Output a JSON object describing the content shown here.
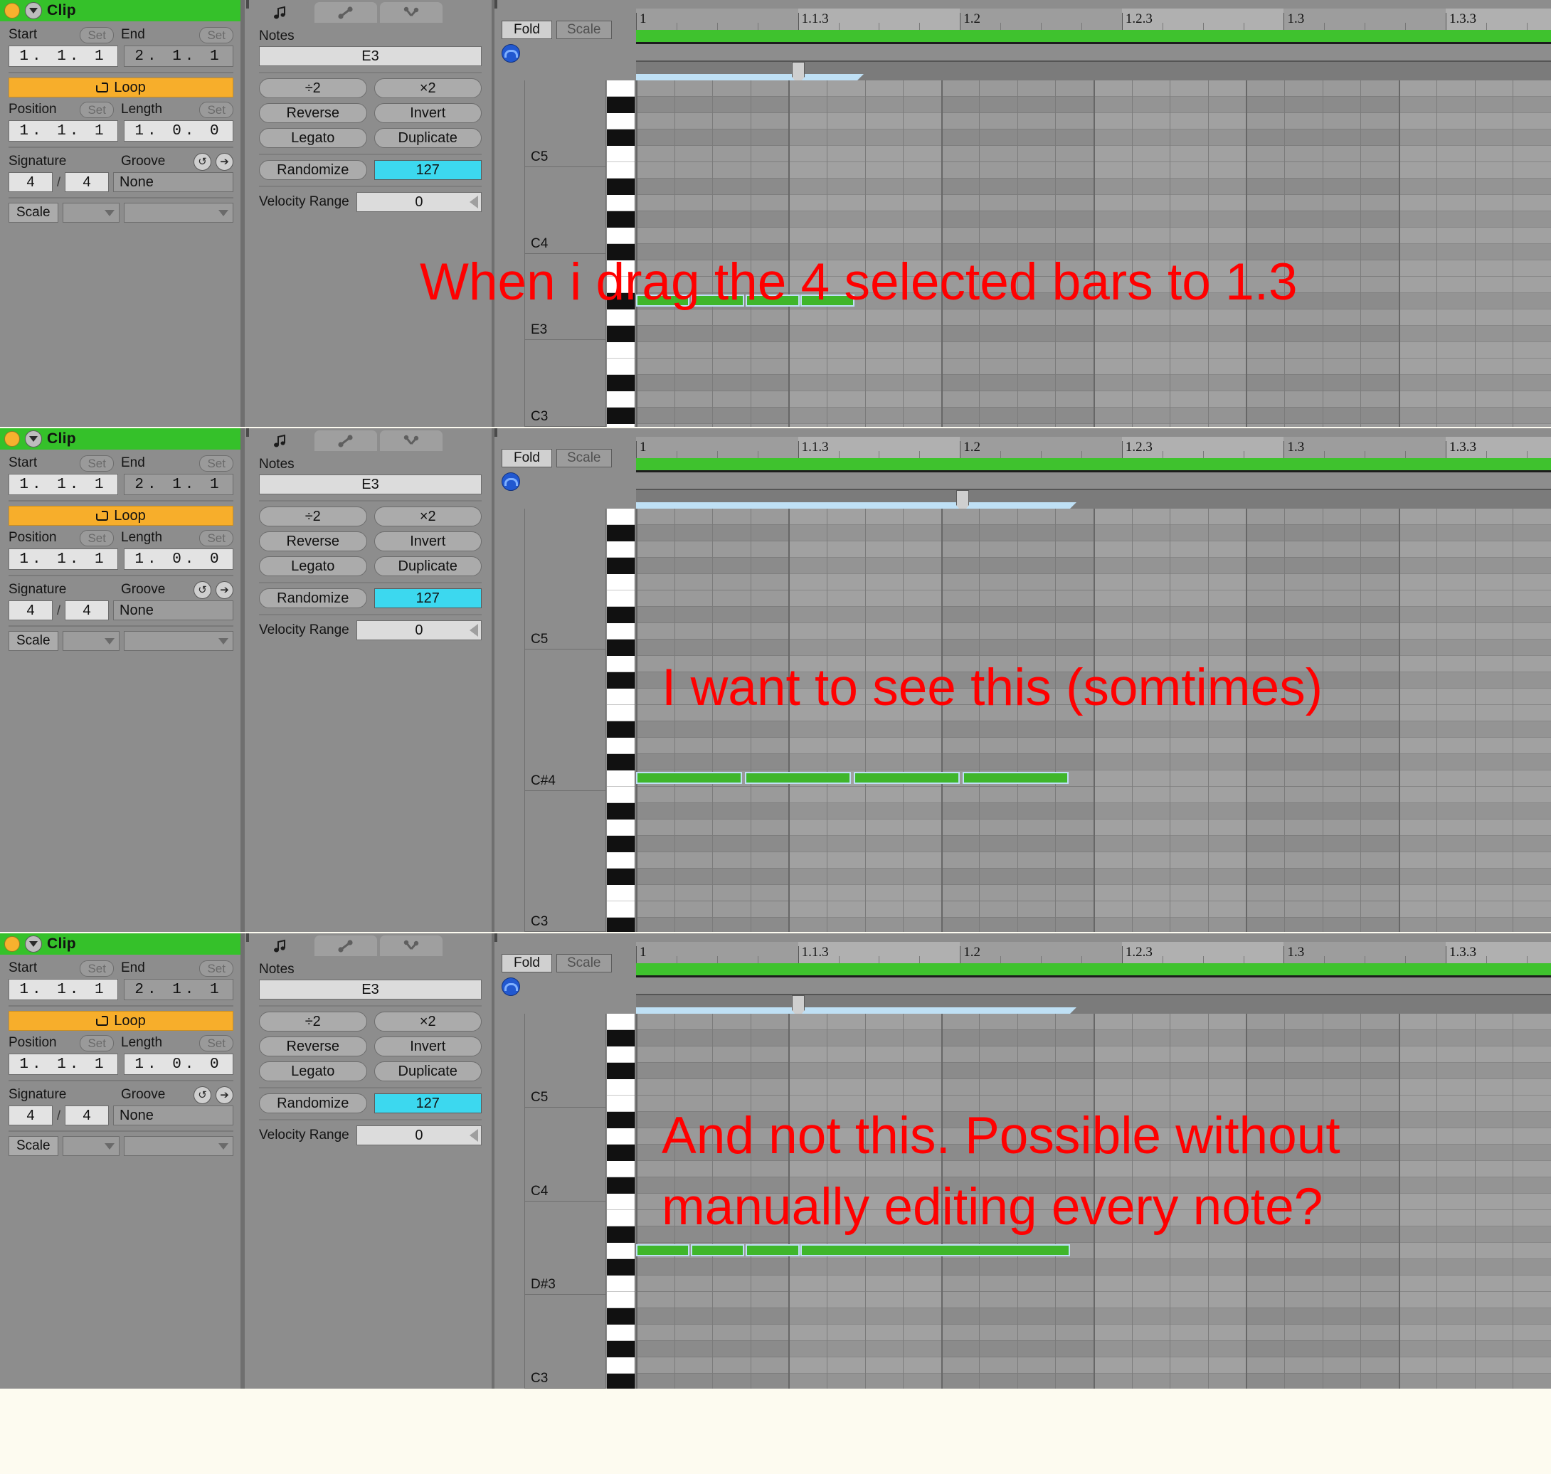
{
  "app": {
    "name": "Ableton Live Clip View",
    "panel_count": 3
  },
  "clip": {
    "title": "Clip",
    "start_label": "Start",
    "end_label": "End",
    "set_label": "Set",
    "start_value": "1. 1. 1",
    "end_value": "2. 1. 1",
    "loop_label": "Loop",
    "position_label": "Position",
    "length_label": "Length",
    "position_value": "1. 1. 1",
    "length_value": "1. 0. 0",
    "signature_label": "Signature",
    "groove_label": "Groove",
    "signature_num": "4",
    "signature_den": "4",
    "groove_value": "None",
    "scale_label": "Scale",
    "scale_root": "",
    "scale_name": "",
    "header_color": "#35c12a",
    "loop_color": "#f7ae2b",
    "dot_color": "#f7b12e"
  },
  "notes_panel": {
    "tabs": [
      {
        "icon": "music-note-icon",
        "active": true
      },
      {
        "icon": "envelope-line-icon",
        "active": false
      },
      {
        "icon": "expression-curve-icon",
        "active": false
      }
    ],
    "notes_label": "Notes",
    "selected_note": "E3",
    "half_label": "÷2",
    "double_label": "×2",
    "reverse_label": "Reverse",
    "invert_label": "Invert",
    "legato_label": "Legato",
    "duplicate_label": "Duplicate",
    "randomize_label": "Randomize",
    "velocity_value": "127",
    "velocity_range_label": "Velocity Range",
    "velocity_range_value": "0",
    "velocity_color": "#3cd8ef"
  },
  "piano_roll": {
    "fold_label": "Fold",
    "scale_label": "Scale",
    "preview_icon": "headphone-icon",
    "ruler_ticks": [
      "1",
      "1.1.3",
      "1.2",
      "1.2.3",
      "1.3",
      "1.3.3"
    ],
    "loop_bar_color": "#3fc22e",
    "selection_color": "#bfe0f5",
    "note_color": "#3fb62b"
  },
  "panels": [
    {
      "id": "panel-1",
      "key_labels": [
        "C5",
        "C4",
        "E3",
        "C3"
      ],
      "note_row_label": "E3",
      "notes": [
        {
          "start_pct": 0.0,
          "width_pct": 5.85
        },
        {
          "start_pct": 6.0,
          "width_pct": 5.85
        },
        {
          "start_pct": 12.0,
          "width_pct": 5.85
        },
        {
          "start_pct": 18.0,
          "width_pct": 5.85
        }
      ],
      "selection_end_pct": 24.2,
      "playhead_pct": 17.0
    },
    {
      "id": "panel-2",
      "key_labels": [
        "C5",
        "C#4",
        "C3"
      ],
      "note_row_label": "C3",
      "notes": [
        {
          "start_pct": 0.0,
          "width_pct": 11.6
        },
        {
          "start_pct": 11.9,
          "width_pct": 11.6
        },
        {
          "start_pct": 23.8,
          "width_pct": 11.6
        },
        {
          "start_pct": 35.7,
          "width_pct": 11.6
        }
      ],
      "selection_end_pct": 47.4,
      "playhead_pct": 35.0
    },
    {
      "id": "panel-3",
      "key_labels": [
        "C5",
        "C4",
        "D#3",
        "C3"
      ],
      "note_row_label": "D#3",
      "notes": [
        {
          "start_pct": 0.0,
          "width_pct": 5.85
        },
        {
          "start_pct": 6.0,
          "width_pct": 5.85
        },
        {
          "start_pct": 12.0,
          "width_pct": 5.85
        },
        {
          "start_pct": 18.0,
          "width_pct": 29.4
        }
      ],
      "selection_end_pct": 47.4,
      "playhead_pct": 17.0
    }
  ],
  "annotations": {
    "line1": "When i drag the 4 selected bars to 1.3",
    "line2": "I want to see this (somtimes)",
    "line3": "And not this. Possible without",
    "line4": "manually editing every note?",
    "color": "#ff0000"
  }
}
